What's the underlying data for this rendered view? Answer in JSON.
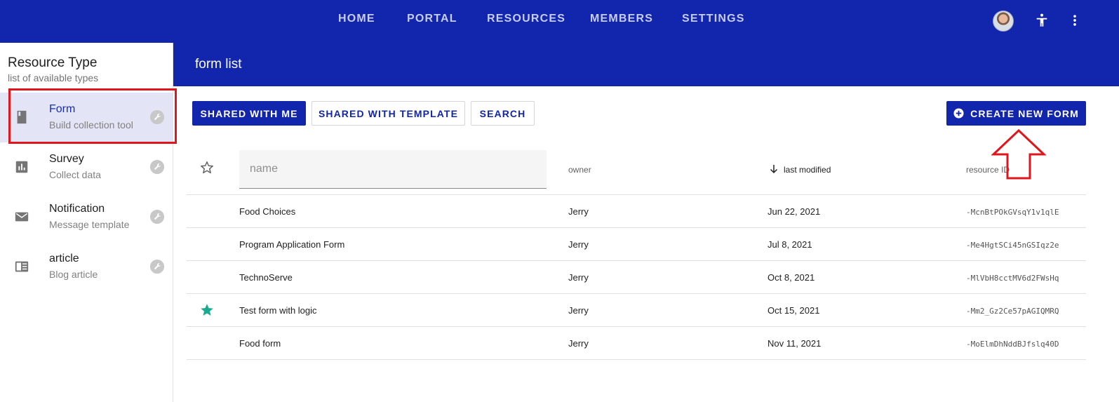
{
  "topnav": {
    "items": [
      "HOME",
      "PORTAL",
      "RESOURCES",
      "MEMBERS",
      "SETTINGS"
    ]
  },
  "sidebar": {
    "title": "Resource Type",
    "subtitle": "list of available types",
    "items": [
      {
        "label": "Form",
        "desc": "Build collection tool",
        "icon": "book-icon"
      },
      {
        "label": "Survey",
        "desc": "Collect data",
        "icon": "bar-chart-icon"
      },
      {
        "label": "Notification",
        "desc": "Message template",
        "icon": "email-icon"
      },
      {
        "label": "article",
        "desc": "Blog article",
        "icon": "article-icon"
      }
    ]
  },
  "main": {
    "title": "form list",
    "buttons": {
      "shared_with_me": "SHARED WITH ME",
      "shared_with_template": "SHARED WITH TEMPLATE",
      "search": "SEARCH",
      "create_new": "CREATE NEW FORM"
    },
    "search_placeholder": "name",
    "columns": {
      "owner": "owner",
      "last_modified": "last modified",
      "resource_id": "resource ID"
    },
    "rows": [
      {
        "starred": false,
        "name": "Food Choices",
        "owner": "Jerry",
        "modified": "Jun 22, 2021",
        "id": "-McnBtPOkGVsqY1v1qlE"
      },
      {
        "starred": false,
        "name": "Program Application Form",
        "owner": "Jerry",
        "modified": "Jul 8, 2021",
        "id": "-Me4HgtSCi45nGSIqz2e"
      },
      {
        "starred": false,
        "name": "TechnoServe",
        "owner": "Jerry",
        "modified": "Oct 8, 2021",
        "id": "-MlVbH8cctMV6d2FWsHq"
      },
      {
        "starred": true,
        "name": "Test form with logic",
        "owner": "Jerry",
        "modified": "Oct 15, 2021",
        "id": "-Mm2_Gz2Ce57pAGIQMRQ"
      },
      {
        "starred": false,
        "name": "Food form",
        "owner": "Jerry",
        "modified": "Nov 11, 2021",
        "id": "-MoElmDhNddBJfslq40D"
      }
    ]
  },
  "colors": {
    "primary": "#1125ad",
    "star_active": "#1aaa8f",
    "annotation": "#e0161d"
  }
}
